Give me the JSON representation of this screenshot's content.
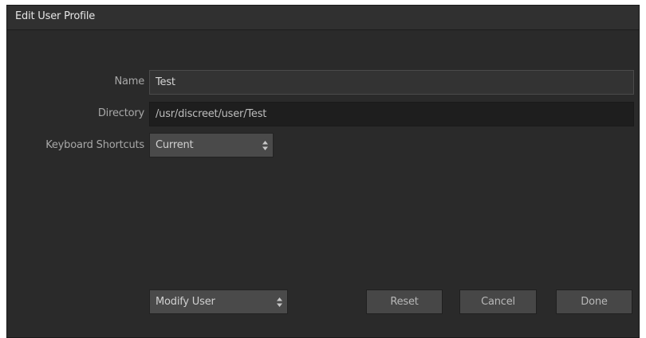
{
  "dialog": {
    "title": "Edit User Profile"
  },
  "form": {
    "name_label": "Name",
    "name_value": "Test",
    "directory_label": "Directory",
    "directory_value": "/usr/discreet/user/Test",
    "shortcuts_label": "Keyboard Shortcuts",
    "shortcuts_value": "Current"
  },
  "footer": {
    "mode_value": "Modify User",
    "reset_label": "Reset",
    "cancel_label": "Cancel",
    "done_label": "Done"
  },
  "colors": {
    "dialog_bg": "#2a2a2a",
    "titlebar_bg": "#303030",
    "button_bg": "#474747",
    "label_text": "#a8a8a8"
  }
}
